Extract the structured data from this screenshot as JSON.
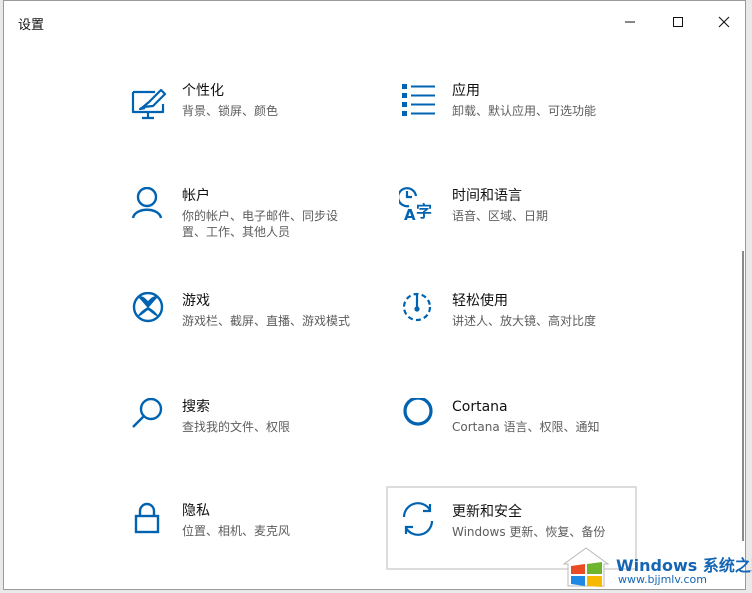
{
  "window": {
    "title": "设置"
  },
  "tiles": [
    {
      "label": "个性化",
      "desc": "背景、锁屏、颜色",
      "icon": "personalization-icon"
    },
    {
      "label": "应用",
      "desc": "卸载、默认应用、可选功能",
      "icon": "apps-icon"
    },
    {
      "label": "帐户",
      "desc": "你的帐户、电子邮件、同步设置、工作、其他人员",
      "icon": "accounts-icon"
    },
    {
      "label": "时间和语言",
      "desc": "语音、区域、日期",
      "icon": "time-language-icon"
    },
    {
      "label": "游戏",
      "desc": "游戏栏、截屏、直播、游戏模式",
      "icon": "xbox-icon"
    },
    {
      "label": "轻松使用",
      "desc": "讲述人、放大镜、高对比度",
      "icon": "ease-of-access-icon"
    },
    {
      "label": "搜索",
      "desc": "查找我的文件、权限",
      "icon": "search-icon"
    },
    {
      "label": "Cortana",
      "desc": "Cortana 语言、权限、通知",
      "icon": "cortana-icon"
    },
    {
      "label": "隐私",
      "desc": "位置、相机、麦克风",
      "icon": "lock-icon"
    },
    {
      "label": "更新和安全",
      "desc": "Windows 更新、恢复、备份",
      "icon": "sync-icon"
    }
  ],
  "watermark": {
    "title": "Windows 系统之家",
    "url": "www.bjjmlv.com"
  },
  "colors": {
    "accent": "#0063b1",
    "text": "#111111",
    "secondary_text": "#5d5d5d"
  }
}
